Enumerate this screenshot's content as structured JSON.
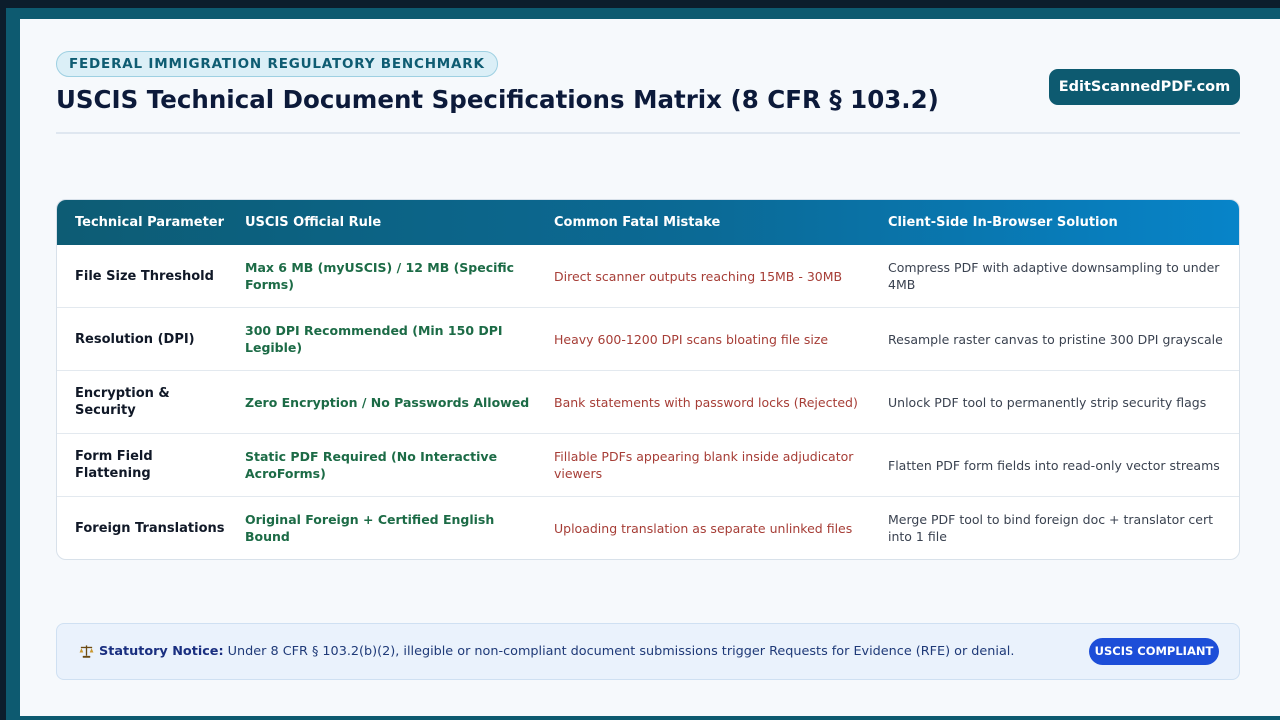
{
  "header": {
    "eyebrow": "FEDERAL IMMIGRATION REGULATORY BENCHMARK",
    "title": "USCIS Technical Document Specifications Matrix (8 CFR § 103.2)",
    "brand_button": "EditScannedPDF.com"
  },
  "table": {
    "columns": [
      "Technical Parameter",
      "USCIS Official Rule",
      "Common Fatal Mistake",
      "Client-Side In-Browser Solution"
    ],
    "rows": [
      {
        "parameter": "File Size Threshold",
        "rule": "Max 6 MB (myUSCIS) / 12 MB (Specific Forms)",
        "mistake": "Direct scanner outputs reaching 15MB - 30MB",
        "solution": "Compress PDF with adaptive downsampling to under 4MB"
      },
      {
        "parameter": "Resolution (DPI)",
        "rule": "300 DPI Recommended (Min 150 DPI Legible)",
        "mistake": "Heavy 600-1200 DPI scans bloating file size",
        "solution": "Resample raster canvas to pristine 300 DPI grayscale"
      },
      {
        "parameter": "Encryption & Security",
        "rule": "Zero Encryption / No Passwords Allowed",
        "mistake": "Bank statements with password locks (Rejected)",
        "solution": "Unlock PDF tool to permanently strip security flags"
      },
      {
        "parameter": "Form Field Flattening",
        "rule": "Static PDF Required (No Interactive AcroForms)",
        "mistake": "Fillable PDFs appearing blank inside adjudicator viewers",
        "solution": "Flatten PDF form fields into read-only vector streams"
      },
      {
        "parameter": "Foreign Translations",
        "rule": "Original Foreign + Certified English Bound",
        "mistake": "Uploading translation as separate unlinked files",
        "solution": "Merge PDF tool to bind foreign doc + translator cert into 1 file"
      }
    ]
  },
  "notice": {
    "icon": "scales-icon",
    "label": "Statutory Notice:",
    "text": " Under 8 CFR § 103.2(b)(2), illegible or non-compliant document submissions trigger Requests for Evidence (RFE) or denial.",
    "badge": "USCIS COMPLIANT"
  },
  "colors": {
    "frame": "#0d5a70",
    "brand": "#0d5a70",
    "rule_text": "#1c6b46",
    "mistake_text": "#a63d36",
    "badge": "#1d4ed8"
  }
}
